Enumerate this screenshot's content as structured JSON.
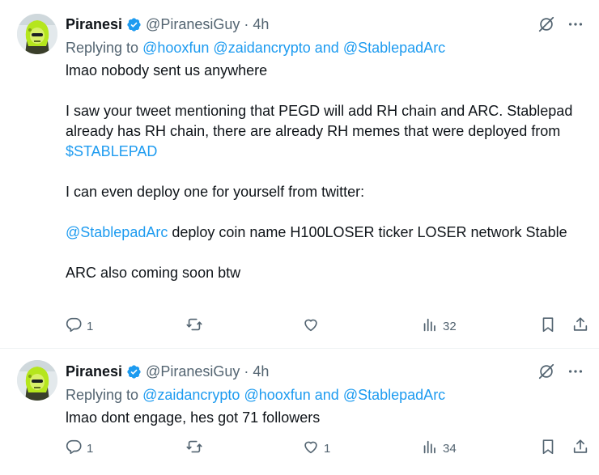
{
  "tweets": [
    {
      "author": {
        "name": "Piranesi",
        "handle": "@PiranesiGuy",
        "dot": "·",
        "time": "4h"
      },
      "replying": {
        "prefix": "Replying to",
        "mention1": "@hooxfun",
        "mention2": "@zaidancrypto",
        "and": "and",
        "mention3": "@StablepadArc"
      },
      "lines": {
        "p1": "lmao nobody sent us anywhere",
        "p2a": "I saw your tweet mentioning that PEGD will add RH chain and ARC. Stablepad already has RH chain, there are already RH memes that were deployed from ",
        "p2_cashtag": "$STABLEPAD",
        "p3": "I can even deploy one for yourself from twitter:",
        "p4_mention": "@StablepadArc",
        "p4_rest": " deploy coin name H100LOSER ticker LOSER network Stable",
        "p5": "ARC also coming soon btw"
      },
      "stats": {
        "replies": "1",
        "reposts": "",
        "likes": "",
        "views": "32"
      }
    },
    {
      "author": {
        "name": "Piranesi",
        "handle": "@PiranesiGuy",
        "dot": "·",
        "time": "4h"
      },
      "replying": {
        "prefix": "Replying to",
        "mention1": "@zaidancrypto",
        "mention2": "@hooxfun",
        "and": "and",
        "mention3": "@StablepadArc"
      },
      "lines": {
        "p1": "lmao dont engage, hes got 71 followers"
      },
      "stats": {
        "replies": "1",
        "reposts": "",
        "likes": "1",
        "views": "34"
      }
    }
  ],
  "colors": {
    "accent": "#1d9bf0",
    "muted": "#536471",
    "text": "#0f1419",
    "avatar_green": "#b5e61d"
  },
  "icons": [
    "verified-badge-icon",
    "grok-icon",
    "more-icon",
    "reply-icon",
    "repost-icon",
    "like-icon",
    "views-icon",
    "bookmark-icon",
    "share-icon"
  ]
}
